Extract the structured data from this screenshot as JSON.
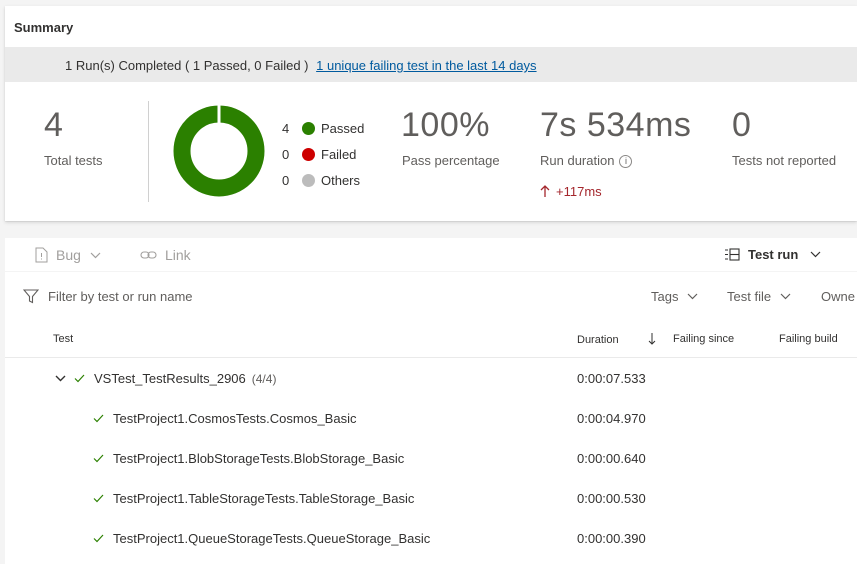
{
  "summary": {
    "title": "Summary",
    "status_text": "1 Run(s) Completed ( 1 Passed, 0 Failed )",
    "status_link": "1 unique failing test in the last 14 days",
    "total_tests": {
      "value": "4",
      "label": "Total tests"
    },
    "donut": {
      "passed": 4,
      "failed": 0,
      "others": 0
    },
    "legend": [
      {
        "count": "4",
        "label": "Passed",
        "color": "#2b8000"
      },
      {
        "count": "0",
        "label": "Failed",
        "color": "#cd0000"
      },
      {
        "count": "0",
        "label": "Others",
        "color": "#bcbcbc"
      }
    ],
    "pass_percentage": {
      "value": "100%",
      "label": "Pass percentage"
    },
    "run_duration": {
      "value": "7s 534ms",
      "label": "Run duration",
      "delta": "+117ms"
    },
    "not_reported": {
      "value": "0",
      "label": "Tests not reported"
    }
  },
  "toolbar": {
    "bug_label": "Bug",
    "link_label": "Link",
    "test_run_label": "Test run"
  },
  "filter": {
    "placeholder": "Filter by test or run name",
    "tags_label": "Tags",
    "test_file_label": "Test file",
    "owner_label": "Owne"
  },
  "grid": {
    "columns": {
      "test": "Test",
      "duration": "Duration",
      "failing_since": "Failing since",
      "failing_build": "Failing build"
    },
    "rows": [
      {
        "name": "VSTest_TestResults_2906",
        "count": "(4/4)",
        "duration": "0:00:07.533"
      },
      {
        "name": "TestProject1.CosmosTests.Cosmos_Basic",
        "duration": "0:00:04.970"
      },
      {
        "name": "TestProject1.BlobStorageTests.BlobStorage_Basic",
        "duration": "0:00:00.640"
      },
      {
        "name": "TestProject1.TableStorageTests.TableStorage_Basic",
        "duration": "0:00:00.530"
      },
      {
        "name": "TestProject1.QueueStorageTests.QueueStorage_Basic",
        "duration": "0:00:00.390"
      }
    ]
  },
  "colors": {
    "passed": "#2b8000",
    "failed": "#cd0000",
    "others": "#bcbcbc",
    "link": "#005a9e",
    "delta": "#a4262c"
  }
}
